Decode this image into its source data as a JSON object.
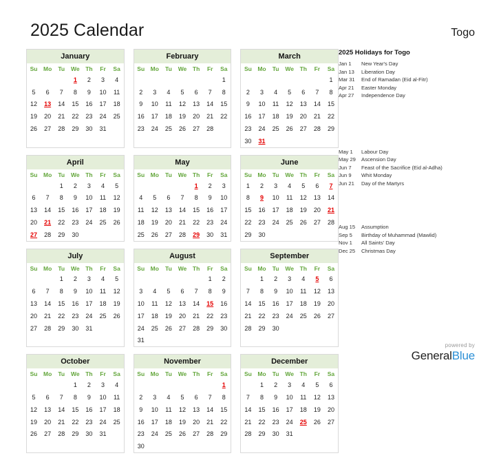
{
  "header": {
    "title": "2025 Calendar",
    "country": "Togo"
  },
  "weekdays": [
    "Su",
    "Mo",
    "Tu",
    "We",
    "Th",
    "Fr",
    "Sa"
  ],
  "colors": {
    "month_header_bg": "#e4eed9",
    "weekday_text": "#63a63b",
    "holiday_text": "#e40000",
    "brand_blue": "#2b8fd6"
  },
  "months": [
    {
      "name": "January",
      "lead_blank": 3,
      "days": 31,
      "holidays": [
        1,
        13
      ]
    },
    {
      "name": "February",
      "lead_blank": 6,
      "days": 28,
      "holidays": []
    },
    {
      "name": "March",
      "lead_blank": 6,
      "days": 31,
      "holidays": [
        31
      ]
    },
    {
      "name": "April",
      "lead_blank": 2,
      "days": 30,
      "holidays": [
        21,
        27
      ]
    },
    {
      "name": "May",
      "lead_blank": 4,
      "days": 31,
      "holidays": [
        1,
        29
      ]
    },
    {
      "name": "June",
      "lead_blank": 0,
      "days": 30,
      "holidays": [
        7,
        9,
        21
      ]
    },
    {
      "name": "July",
      "lead_blank": 2,
      "days": 31,
      "holidays": []
    },
    {
      "name": "August",
      "lead_blank": 5,
      "days": 31,
      "holidays": [
        15
      ]
    },
    {
      "name": "September",
      "lead_blank": 1,
      "days": 30,
      "holidays": [
        5
      ]
    },
    {
      "name": "October",
      "lead_blank": 3,
      "days": 31,
      "holidays": []
    },
    {
      "name": "November",
      "lead_blank": 6,
      "days": 30,
      "holidays": [
        1
      ]
    },
    {
      "name": "December",
      "lead_blank": 1,
      "days": 31,
      "holidays": [
        25
      ]
    }
  ],
  "holidays_panel": {
    "title": "2025 Holidays for Togo",
    "groups": [
      {
        "items": [
          {
            "date": "Jan 1",
            "name": "New Year's Day"
          },
          {
            "date": "Jan 13",
            "name": "Liberation Day"
          },
          {
            "date": "Mar 31",
            "name": "End of Ramadan (Eid al-Fitr)"
          },
          {
            "date": "Apr 21",
            "name": "Easter Monday"
          },
          {
            "date": "Apr 27",
            "name": "Independence Day"
          }
        ]
      },
      {
        "items": [
          {
            "date": "May 1",
            "name": "Labour Day"
          },
          {
            "date": "May 29",
            "name": "Ascension Day"
          },
          {
            "date": "Jun 7",
            "name": "Feast of the Sacrifice (Eid al-Adha)"
          },
          {
            "date": "Jun 9",
            "name": "Whit Monday"
          },
          {
            "date": "Jun 21",
            "name": "Day of the Martyrs"
          }
        ]
      },
      {
        "items": [
          {
            "date": "Aug 15",
            "name": "Assumption"
          },
          {
            "date": "Sep 5",
            "name": "Birthday of Muhammad (Mawlid)"
          },
          {
            "date": "Nov 1",
            "name": "All Saints' Day"
          },
          {
            "date": "Dec 25",
            "name": "Christmas Day"
          }
        ]
      }
    ]
  },
  "footer": {
    "powered_by": "powered by",
    "brand_first": "General",
    "brand_second": "Blue"
  }
}
